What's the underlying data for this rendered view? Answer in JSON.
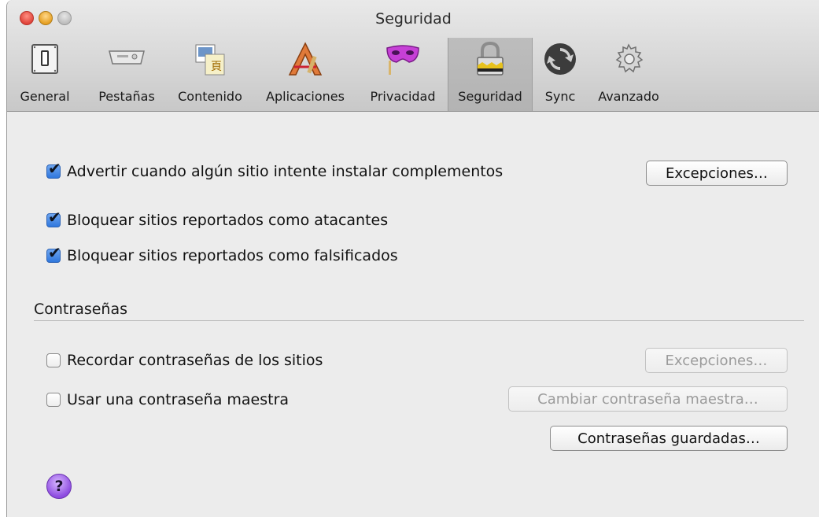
{
  "window": {
    "title": "Seguridad"
  },
  "tabs": [
    {
      "label": "General",
      "icon": "general-switch-icon"
    },
    {
      "label": "Pestañas",
      "icon": "tabs-icon"
    },
    {
      "label": "Contenido",
      "icon": "content-icon"
    },
    {
      "label": "Aplicaciones",
      "icon": "applications-icon"
    },
    {
      "label": "Privacidad",
      "icon": "privacy-mask-icon"
    },
    {
      "label": "Seguridad",
      "icon": "security-lock-icon",
      "selected": true
    },
    {
      "label": "Sync",
      "icon": "sync-icon"
    },
    {
      "label": "Avanzado",
      "icon": "advanced-gear-icon"
    }
  ],
  "security": {
    "warn_addons": {
      "label": "Advertir cuando algún sitio intente instalar complementos",
      "checked": true
    },
    "exceptions_button": "Excepciones…",
    "block_attack": {
      "label": "Bloquear sitios reportados como atacantes",
      "checked": true
    },
    "block_forgery": {
      "label": "Bloquear sitios reportados como falsificados",
      "checked": true
    }
  },
  "passwords": {
    "section_title": "Contraseñas",
    "remember": {
      "label": "Recordar contraseñas de los sitios",
      "checked": false
    },
    "exceptions_button": "Excepciones…",
    "master": {
      "label": "Usar una contraseña maestra",
      "checked": false
    },
    "change_master_button": "Cambiar contraseña maestra…",
    "saved_button": "Contraseñas guardadas…"
  },
  "help": {
    "glyph": "?"
  },
  "colors": {
    "checkbox_blue": "#2f77dd",
    "help_purple": "#8d4be0",
    "toolbar_bg": "#d6d6d6"
  }
}
